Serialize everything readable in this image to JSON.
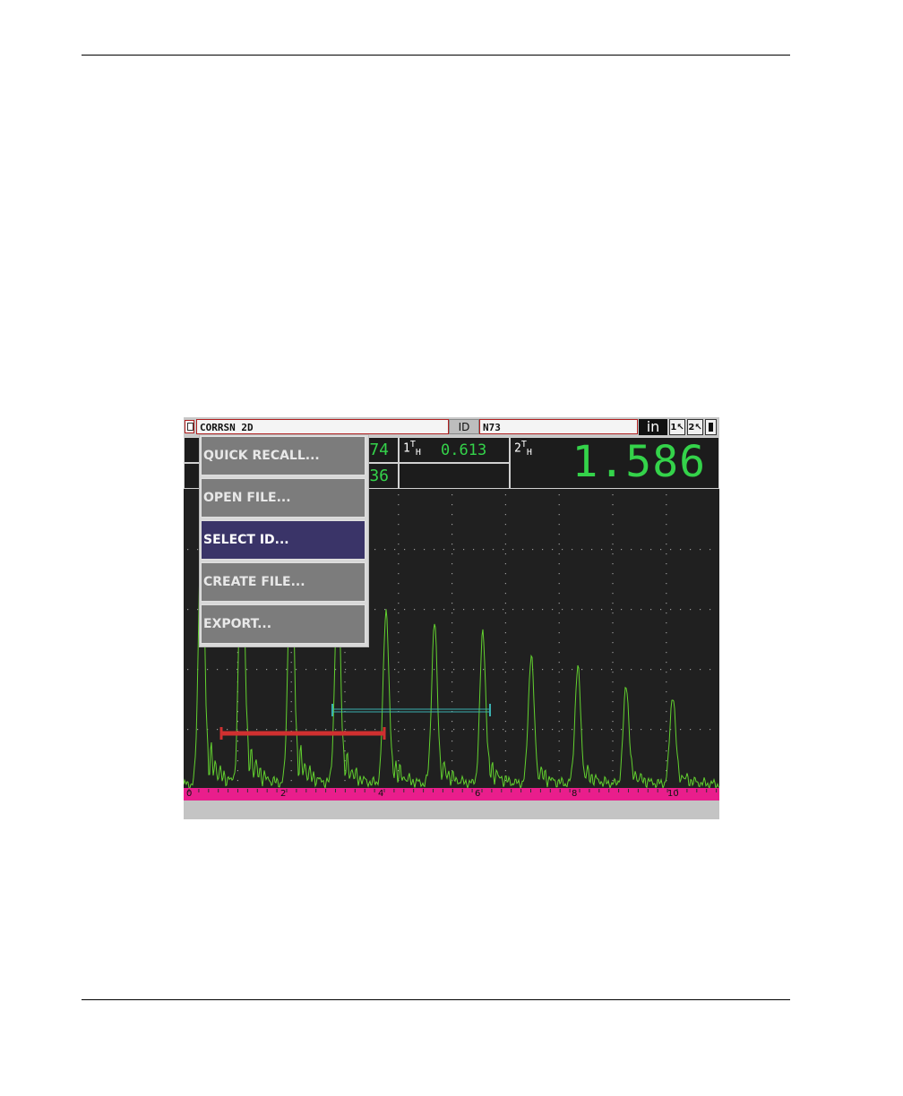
{
  "titlebar": {
    "file_name": "CORRSN 2D",
    "id_label": "ID",
    "id_value": "N73",
    "units": "in"
  },
  "readings": {
    "left_top_value": "74",
    "left_bottom_value": "36",
    "gate1_label": "1",
    "gate1_sup": "T",
    "gate1_sub": "H",
    "gate1_value": "0.613",
    "gate2_label": "2",
    "gate2_sup": "T",
    "gate2_sub": "H",
    "gate2_value": "1.586"
  },
  "menu": {
    "items": [
      {
        "label": "QUICK RECALL..."
      },
      {
        "label": "OPEN FILE..."
      },
      {
        "label": "SELECT ID...",
        "selected": true
      },
      {
        "label": "CREATE FILE..."
      },
      {
        "label": "EXPORT..."
      }
    ]
  },
  "ruler": {
    "labels": [
      "0",
      "2",
      "4",
      "6",
      "8",
      "10"
    ]
  },
  "colors": {
    "waveform": "#62d12f",
    "gate1": "#d03030",
    "gate2": "#3ab0b0",
    "ruler": "#e91e8c",
    "menu_selected": "#3a3468"
  }
}
